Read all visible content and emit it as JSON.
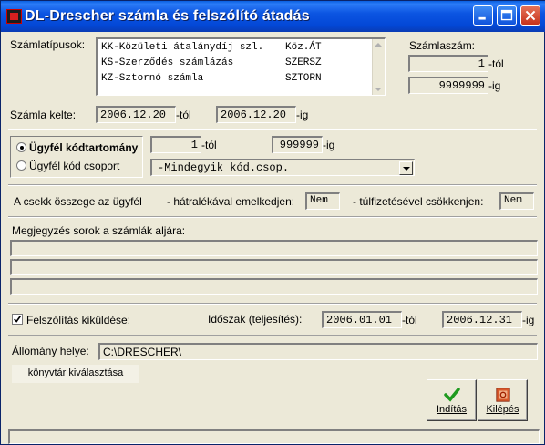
{
  "window": {
    "title": "DL-Drescher számla és felszólító átadás"
  },
  "types": {
    "label": "Számlatípusok:",
    "items": [
      {
        "name": "KK-Közületi átalánydíj szl.",
        "code": "Köz.ÁT"
      },
      {
        "name": "KS-Szerződés számlázás",
        "code": "SZERSZ"
      },
      {
        "name": "KZ-Sztornó számla",
        "code": "SZTORN"
      }
    ]
  },
  "invoice_no": {
    "label": "Számlaszám:",
    "from": "1",
    "from_suffix": "-tól",
    "to": "9999999",
    "to_suffix": "-ig"
  },
  "invoice_date": {
    "label": "Számla kelte:",
    "from": "2006.12.20",
    "from_suffix": "-tól",
    "to": "2006.12.20",
    "to_suffix": "-ig"
  },
  "client": {
    "option_range": "Ügyfél kódtartomány",
    "option_group": "Ügyfél kód csoport",
    "selected": "range",
    "from": "1",
    "from_suffix": "-tól",
    "to": "999999",
    "to_suffix": "-ig",
    "group_value": "-Mindegyik kód.csop."
  },
  "cheque": {
    "text": "A csekk összege az ügyfél",
    "arrears_label": "- hátralékával emelkedjen:",
    "arrears_value": "Nem",
    "overpay_label": "- túlfizetésével csökkenjen:",
    "overpay_value": "Nem"
  },
  "notes": {
    "label": "Megjegyzés sorok a számlák aljára:",
    "lines": [
      "",
      "",
      ""
    ]
  },
  "reminder": {
    "checkbox_label": "Felszólítás kiküldése:",
    "checked": true,
    "period_label": "Időszak (teljesítés):",
    "from": "2006.01.01",
    "from_suffix": "-tól",
    "to": "2006.12.31",
    "to_suffix": "-ig"
  },
  "location": {
    "label": "Állomány helye:",
    "value": "C:\\DRESCHER\\",
    "browse_label": "könyvtár kiválasztása"
  },
  "actions": {
    "start_label": "Indítás",
    "exit_label": "Kilépés"
  },
  "status": {
    "text": ""
  }
}
